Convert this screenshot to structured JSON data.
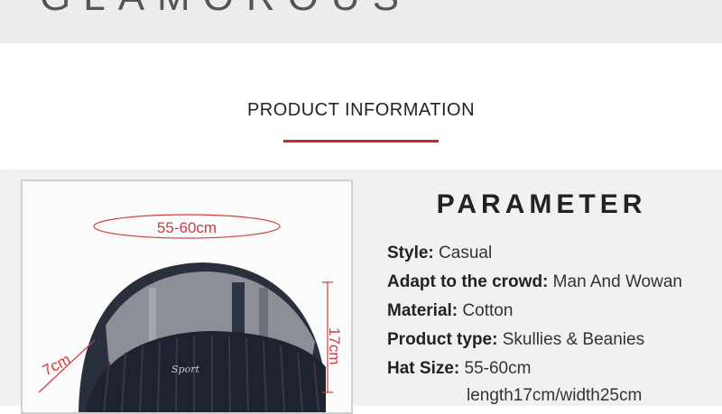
{
  "header": {
    "brand_text": "GLAMOROUS"
  },
  "product_info": {
    "title": "PRODUCT  INFORMATION",
    "accent_color": "#c62a2a"
  },
  "photo": {
    "circumference_label": "55-60cm",
    "height_label": "17cm",
    "brim_label": "7cm",
    "logo_text": "Sport"
  },
  "parameter": {
    "title": "PARAMETER",
    "specs": [
      {
        "key": "Style:",
        "value": "Casual"
      },
      {
        "key": "Adapt to the crowd:",
        "value": "Man And Wowan"
      },
      {
        "key": "Material:",
        "value": "Cotton"
      },
      {
        "key": "Product type:",
        "value": "Skullies & Beanies"
      },
      {
        "key": "Hat Size:",
        "value": "55-60cm"
      }
    ],
    "size_detail": "length17cm/width25cm"
  }
}
